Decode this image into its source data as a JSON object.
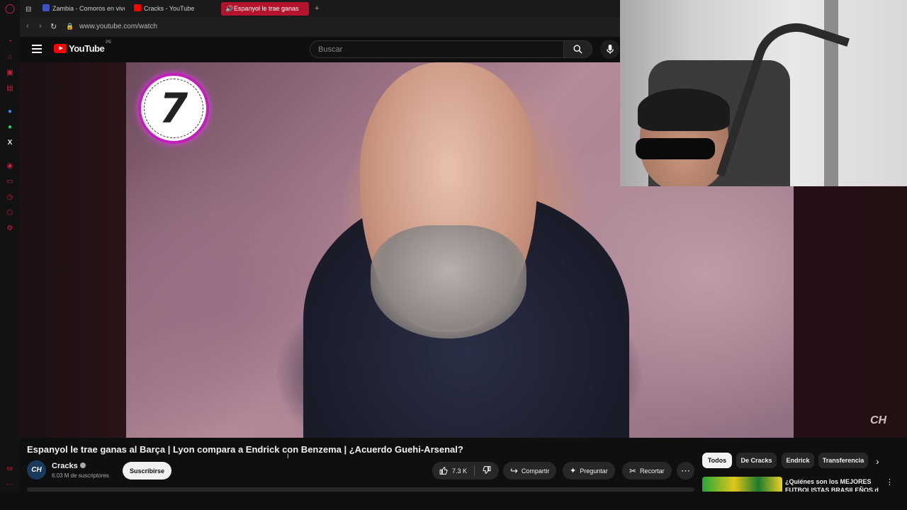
{
  "browser": {
    "tabs": [
      {
        "label": "Zambia - Comoros en vivo",
        "icon": "zambia-favicon",
        "color": "#3b55c7"
      },
      {
        "label": "Cracks - YouTube",
        "icon": "youtube-favicon",
        "color": "#ff0000"
      },
      {
        "label": "Espanyol le trae ganas",
        "icon": "speaker-icon",
        "active": true
      }
    ],
    "new_tab": "+",
    "url": "www.youtube.com/watch",
    "sidebar_bottom_label": "0X"
  },
  "youtube": {
    "logo_text": "YouTube",
    "region": "PE",
    "search_placeholder": "Buscar"
  },
  "video": {
    "badge_number": "7",
    "watermark": "CH"
  },
  "details": {
    "title": "Espanyol le trae ganas al Barça | Lyon compara a Endrick con Benzema | ¿Acuerdo Guehi-Arsenal?",
    "channel_name": "Cracks",
    "channel_initials": "CH",
    "subscribers": "6.03 M de suscriptores",
    "subscribe_label": "Suscribirse",
    "likes": "7.3 K",
    "share_label": "Compartir",
    "ask_label": "Preguntar",
    "clip_label": "Recortar",
    "more": "⋯"
  },
  "chips": [
    {
      "label": "Todos",
      "active": true
    },
    {
      "label": "De Cracks"
    },
    {
      "label": "Endrick"
    },
    {
      "label": "Transferencia"
    }
  ],
  "recommendation": {
    "title": "¿Quiénes son los MEJORES FUTBOLISTAS BRASILEÑOS d"
  },
  "colors": {
    "accent": "#b3142c",
    "youtube_red": "#ff0000",
    "badge_ring": "#c21ebd"
  }
}
